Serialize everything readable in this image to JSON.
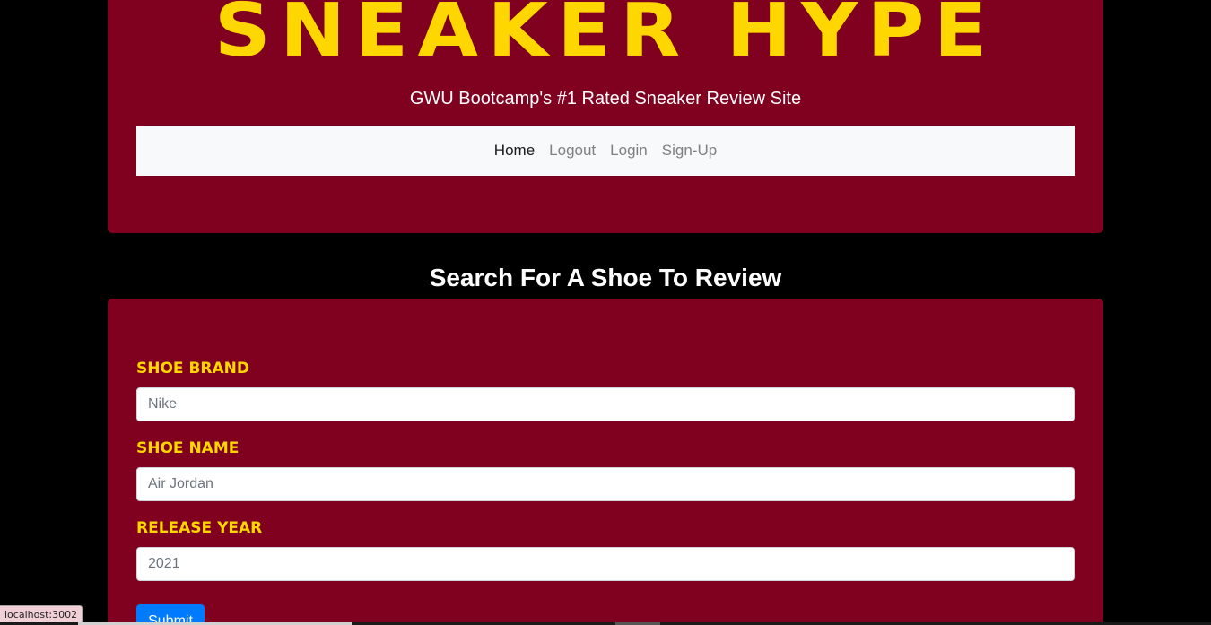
{
  "header": {
    "title": "SNEAKER HYPE",
    "tagline": "GWU Bootcamp's #1 Rated Sneaker Review Site"
  },
  "nav": {
    "items": [
      {
        "label": "Home",
        "active": true
      },
      {
        "label": "Logout",
        "active": false
      },
      {
        "label": "Login",
        "active": false
      },
      {
        "label": "Sign-Up",
        "active": false
      }
    ]
  },
  "search": {
    "heading": "Search For A Shoe To Review",
    "fields": [
      {
        "label": "SHOE BRAND",
        "placeholder": "Nike"
      },
      {
        "label": "SHOE NAME",
        "placeholder": "Air Jordan"
      },
      {
        "label": "RELEASE YEAR",
        "placeholder": "2021"
      }
    ],
    "submit_label": "Submit"
  },
  "status_bar": {
    "url": "localhost:3002"
  },
  "colors": {
    "background": "#000000",
    "panel": "#800020",
    "accent": "#FFD700",
    "navbar": "#f8f9fa",
    "button": "#007bff"
  }
}
